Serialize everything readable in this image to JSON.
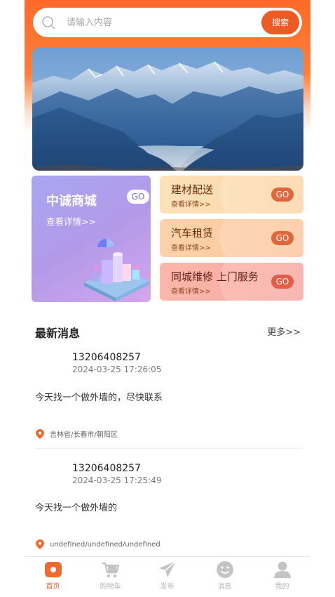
{
  "search": {
    "placeholder": "请输入内容",
    "button_label": "搜索"
  },
  "banner": {
    "icon": "mountain-landscape-image"
  },
  "mall_card": {
    "title": "中诚商城",
    "subtitle": "查看详情>>",
    "go_label": "GO"
  },
  "services": [
    {
      "title": "建材配送",
      "subtitle": "查看详情>>",
      "go_label": "GO"
    },
    {
      "title": "汽车租赁",
      "subtitle": "查看详情>>",
      "go_label": "GO"
    },
    {
      "title": "同城维修 上门服务",
      "subtitle": "查看详情>>",
      "go_label": "GO"
    }
  ],
  "news": {
    "title": "最新消息",
    "more_label": "更多>>",
    "posts": [
      {
        "phone": "13206408257",
        "time": "2024-03-25 17:26:05",
        "content": "今天找一个做外墙的，尽快联系",
        "location": "吉林省/长春市/朝阳区"
      },
      {
        "phone": "13206408257",
        "time": "2024-03-25 17:25:49",
        "content": "今天找一个做外墙的",
        "location": "undefined/undefined/undefined"
      }
    ]
  },
  "tabbar": {
    "items": [
      {
        "label": "首页",
        "icon": "home-icon",
        "active": true
      },
      {
        "label": "购物车",
        "icon": "cart-icon",
        "active": false
      },
      {
        "label": "发布",
        "icon": "send-icon",
        "active": false
      },
      {
        "label": "消息",
        "icon": "message-icon",
        "active": false
      },
      {
        "label": "我的",
        "icon": "user-icon",
        "active": false
      }
    ]
  },
  "colors": {
    "accent": "#ee5a24",
    "header": "#ff6a2a",
    "tab_active": "#ef6a2c"
  }
}
